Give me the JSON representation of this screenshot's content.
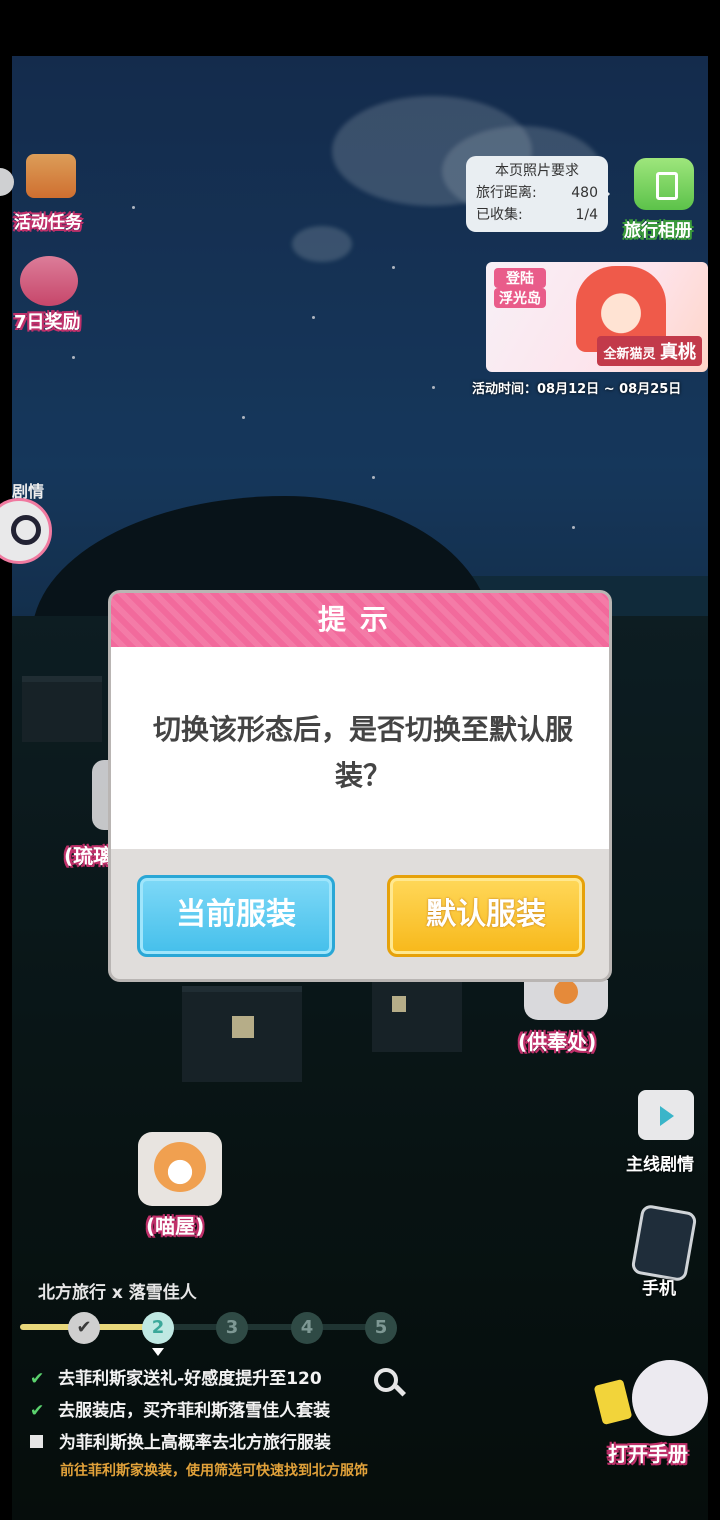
{
  "hud": {
    "activity_tasks": "活动任务",
    "seven_day_reward": "7日奖励",
    "plot_partial": "剧情",
    "photo_req_title": "本页照片要求",
    "travel_distance_label": "旅行距离:",
    "travel_distance_value": "480",
    "collected_label": "已收集:",
    "collected_value": "1/4",
    "travel_album": "旅行相册",
    "banner_line1": "登陆",
    "banner_line2": "浮光岛",
    "banner_caption": "全新猫灵",
    "banner_name": "真桃",
    "event_time": "活动时间：08月12日 ~ 08月25日"
  },
  "places": {
    "liuli_partial": "(琉璃",
    "gongfeng": "(供奉处)",
    "miaowu": "(喵屋)"
  },
  "side": {
    "main_story": "主线剧情",
    "phone": "手机",
    "open_handbook": "打开手册"
  },
  "dialog": {
    "title": "提示",
    "message": "切换该形态后，是否切换至默认服装？",
    "current_outfit": "当前服装",
    "default_outfit": "默认服装"
  },
  "quest": {
    "title": "北方旅行 x 落雪佳人",
    "steps": [
      "2",
      "3",
      "4",
      "5"
    ],
    "items": [
      {
        "text": "去菲利斯家送礼-好感度提升至120",
        "done": true
      },
      {
        "text": "去服装店，买齐菲利斯落雪佳人套装",
        "done": true
      },
      {
        "text": "为菲利斯换上高概率去北方旅行服装",
        "done": false
      }
    ],
    "hint": "前往菲利斯家换装，使用筛选可快速找到北方服饰"
  }
}
